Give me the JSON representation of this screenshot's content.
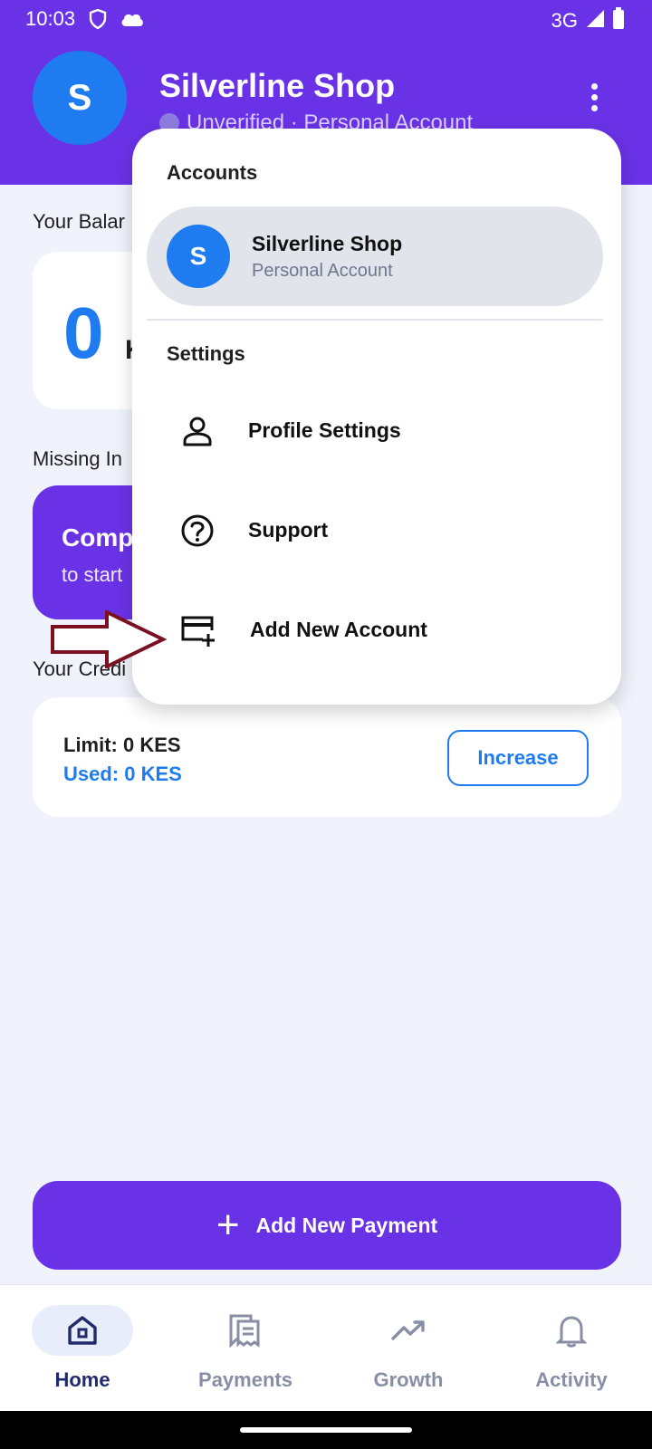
{
  "status": {
    "time": "10:03",
    "network": "3G"
  },
  "header": {
    "avatar_initial": "S",
    "title": "Silverline Shop",
    "subtitle": "Unverified · Personal Account"
  },
  "home": {
    "balance_label": "Your Balar",
    "balance_value": "0",
    "balance_unit": "K",
    "missing_label": "Missing In",
    "missing_title": "Comp",
    "missing_sub": "to start",
    "credit_label": "Your Credi",
    "limit_text": "Limit: 0 KES",
    "used_text": "Used: 0 KES",
    "increase_label": "Increase"
  },
  "menu": {
    "accounts_heading": "Accounts",
    "account": {
      "initial": "S",
      "name": "Silverline Shop",
      "type": "Personal Account"
    },
    "settings_heading": "Settings",
    "items": [
      {
        "label": "Profile Settings",
        "icon": "person-icon"
      },
      {
        "label": "Support",
        "icon": "help-circle-icon"
      },
      {
        "label": "Add New Account",
        "icon": "card-plus-icon"
      }
    ]
  },
  "add_payment_label": "Add New Payment",
  "nav": {
    "items": [
      {
        "label": "Home",
        "icon": "home-icon",
        "active": true
      },
      {
        "label": "Payments",
        "icon": "receipt-icon",
        "active": false
      },
      {
        "label": "Growth",
        "icon": "trending-up-icon",
        "active": false
      },
      {
        "label": "Activity",
        "icon": "bell-icon",
        "active": false
      }
    ]
  },
  "colors": {
    "brand_purple": "#6a32e6",
    "accent_blue": "#1e7cf0",
    "annotation_arrow": "#7a1020"
  }
}
